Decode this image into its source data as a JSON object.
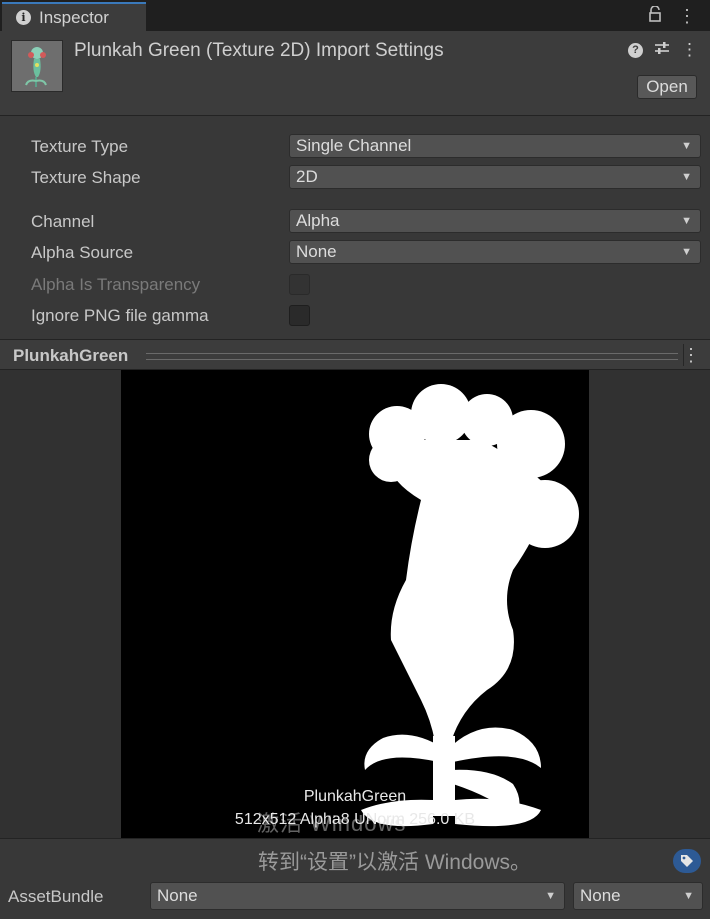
{
  "tab": {
    "label": "Inspector",
    "icon": "info-icon"
  },
  "tabbar_icons": [
    "lock-icon",
    "kebab-menu-icon"
  ],
  "header": {
    "title": "Plunkah Green (Texture 2D) Import Settings",
    "open_button": "Open",
    "icons": [
      "help-icon",
      "presets-icon",
      "kebab-menu-icon"
    ]
  },
  "settings": {
    "texture_type": {
      "label": "Texture Type",
      "value": "Single Channel"
    },
    "texture_shape": {
      "label": "Texture Shape",
      "value": "2D"
    },
    "channel": {
      "label": "Channel",
      "value": "Alpha"
    },
    "alpha_source": {
      "label": "Alpha Source",
      "value": "None"
    },
    "alpha_is_transparency": {
      "label": "Alpha Is Transparency",
      "checked": false,
      "disabled": true
    },
    "ignore_png_gamma": {
      "label": "Ignore PNG file gamma",
      "checked": false
    }
  },
  "preview": {
    "title": "PlunkahGreen",
    "name": "PlunkahGreen",
    "info": "512x512  Alpha8  UNorm  256.0 KB"
  },
  "watermark": {
    "line1": "激活 Windows",
    "line2": "转到“设置”以激活 Windows。"
  },
  "asset_bundle": {
    "label": "AssetBundle",
    "name_value": "None",
    "variant_value": "None"
  },
  "colors": {
    "accent": "#3a79bb",
    "background": "#383838",
    "tag_badge": "#2d5a95"
  }
}
